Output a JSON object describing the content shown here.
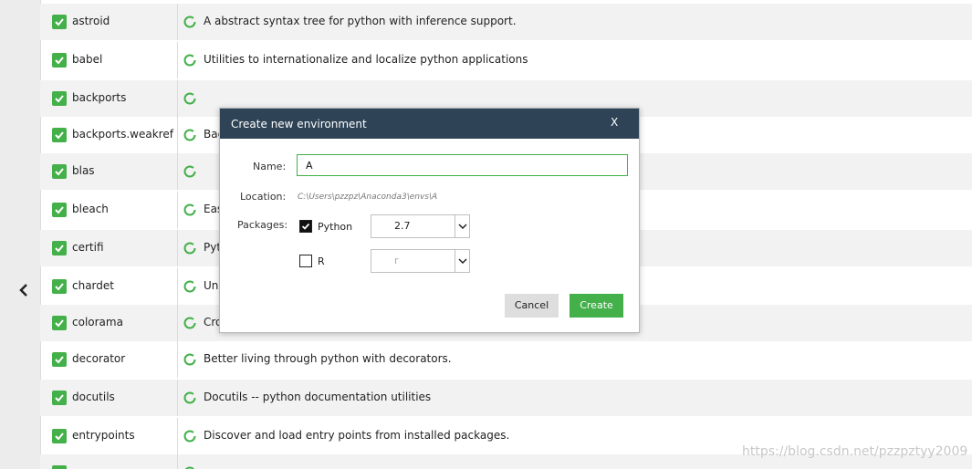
{
  "colors": {
    "accent": "#43b049",
    "dialog_header": "#2e4356",
    "row_alt": "#f2f2f2"
  },
  "packages": [
    {
      "name": "astroid",
      "description": "A abstract syntax tree for python with inference support."
    },
    {
      "name": "babel",
      "description": "Utilities to internationalize and localize python applications"
    },
    {
      "name": "backports",
      "description": ""
    },
    {
      "name": "backports.weakref",
      "description": "Bac"
    },
    {
      "name": "blas",
      "description": ""
    },
    {
      "name": "bleach",
      "description": "Eas"
    },
    {
      "name": "certifi",
      "description": "Pyt"
    },
    {
      "name": "chardet",
      "description": "Uni"
    },
    {
      "name": "colorama",
      "description": "Cro"
    },
    {
      "name": "decorator",
      "description": "Better living through python with decorators."
    },
    {
      "name": "docutils",
      "description": "Docutils -- python documentation utilities"
    },
    {
      "name": "entrypoints",
      "description": "Discover and load entry points from installed packages."
    },
    {
      "name": "",
      "description": ""
    }
  ],
  "dialog": {
    "title": "Create new environment",
    "close_label": "X",
    "name_label": "Name:",
    "name_value": "A",
    "location_label": "Location:",
    "location_value": "C:\\Users\\pzzpz\\Anaconda3\\envs\\A",
    "packages_label": "Packages:",
    "python_label": "Python",
    "python_checked": true,
    "python_version": "2.7",
    "r_label": "R",
    "r_checked": false,
    "r_version": "r",
    "cancel_label": "Cancel",
    "create_label": "Create"
  },
  "watermark": "https://blog.csdn.net/pzzpztyy2009",
  "icons": {
    "collapse": "chevron-left-icon",
    "status": "circle-status-icon",
    "check": "checkmark-icon",
    "dropdown": "chevron-down-icon"
  }
}
